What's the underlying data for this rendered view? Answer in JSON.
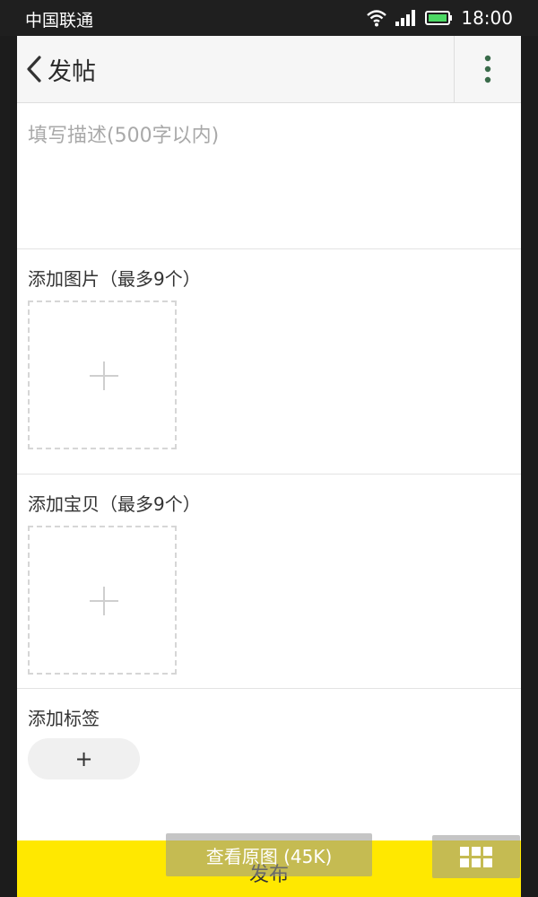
{
  "status_bar": {
    "carrier": "中国联通",
    "time": "18:00",
    "icons": [
      "wifi-icon",
      "signal-icon",
      "battery-icon"
    ]
  },
  "header": {
    "back_icon": "chevron-left-icon",
    "title": "发帖",
    "more_icon": "more-vertical-icon"
  },
  "description": {
    "placeholder": "填写描述(500字以内)"
  },
  "images": {
    "label": "添加图片（最多9个）",
    "add_symbol": "+"
  },
  "items": {
    "label": "添加宝贝（最多9个）",
    "add_symbol": "+"
  },
  "tags": {
    "label": "添加标签",
    "add_symbol": "+"
  },
  "footer": {
    "publish_label": "发布"
  },
  "overlay": {
    "view_original_label": "查看原图 (45K)",
    "grid_icon": "grid-icon"
  },
  "colors": {
    "accent": "#ffe800",
    "header_bg": "#f6f6f6"
  }
}
